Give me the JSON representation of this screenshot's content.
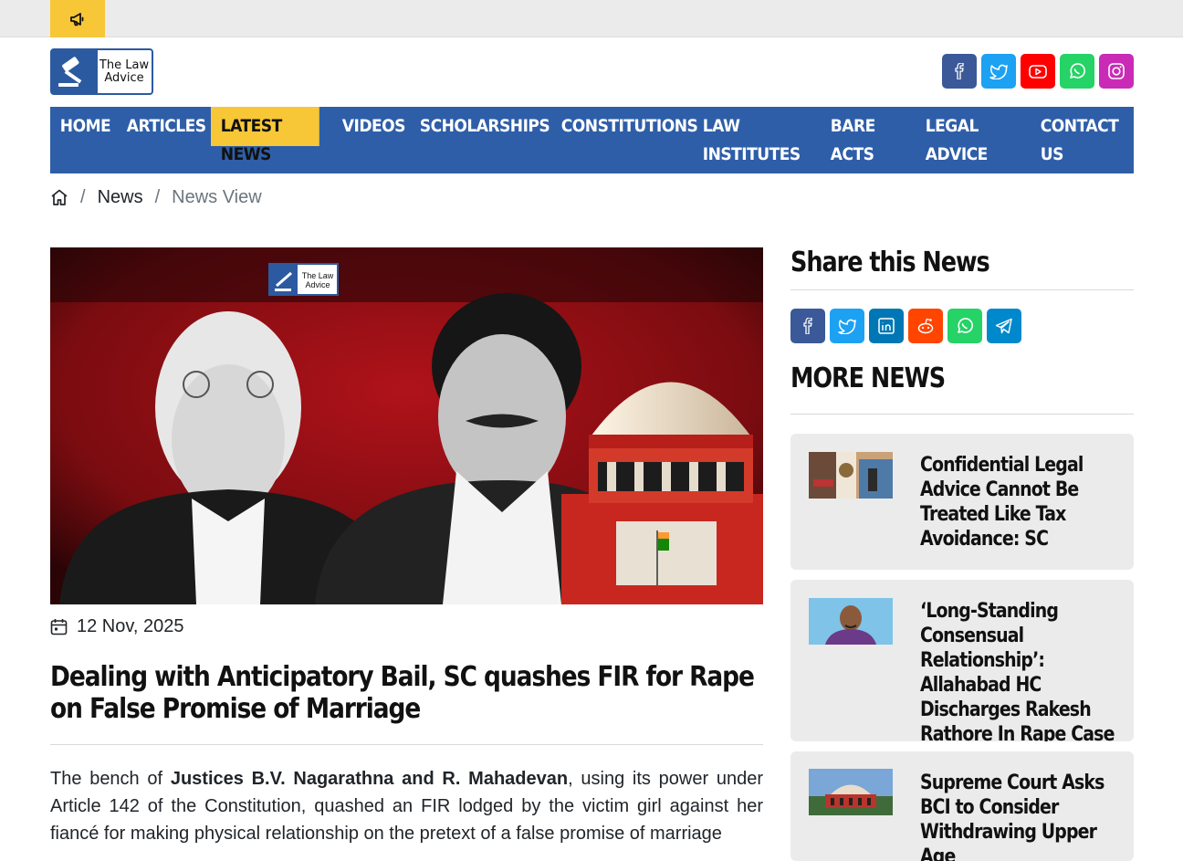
{
  "topbar": {
    "announcement_icon": "megaphone-icon"
  },
  "logo": {
    "line1": "The Law",
    "line2": "Advice"
  },
  "socials": [
    {
      "name": "facebook-icon",
      "color": "#3b5998"
    },
    {
      "name": "twitter-icon",
      "color": "#1da1f2"
    },
    {
      "name": "youtube-icon",
      "color": "#ff0000"
    },
    {
      "name": "whatsapp-icon",
      "color": "#25d366"
    },
    {
      "name": "instagram-icon",
      "color": "#c13584"
    }
  ],
  "nav": {
    "items": [
      {
        "label": "HOME"
      },
      {
        "label": "ARTICLES"
      },
      {
        "label": "LATEST NEWS",
        "active": true
      },
      {
        "label": "VIDEOS"
      },
      {
        "label": "SCHOLARSHIPS"
      },
      {
        "label": "CONSTITUTIONS"
      },
      {
        "label": "LAW INSTITUTES"
      },
      {
        "label": "BARE ACTS"
      },
      {
        "label": "LEGAL ADVICE"
      },
      {
        "label": "CONTACT US"
      }
    ],
    "bg_color": "#2e5ea8",
    "active_color": "#f7c737"
  },
  "breadcrumb": {
    "home_icon": "home-icon",
    "sep": "/",
    "news": "News",
    "current": "News View"
  },
  "hero": {
    "logo_line1": "The Law",
    "logo_line2": "Advice"
  },
  "article": {
    "date": "12 Nov, 2025",
    "title": "Dealing with Anticipatory Bail, SC quashes FIR for Rape on False Promise of Marriage",
    "body_prefix": "The bench of ",
    "body_bold": "Justices B.V. Nagarathna and R. Mahadevan",
    "body_rest": ", using its power under Article 142 of the Constitution, quashed an FIR lodged by the victim girl against her fiancé for making physical relationship on the pretext of a false promise of marriage"
  },
  "sidebar": {
    "share_heading": "Share this News",
    "share_buttons": [
      {
        "name": "share-facebook-icon",
        "color": "#3b5998"
      },
      {
        "name": "share-twitter-icon",
        "color": "#1da1f2"
      },
      {
        "name": "share-linkedin-icon",
        "color": "#0077b5"
      },
      {
        "name": "share-reddit-icon",
        "color": "#ff4500"
      },
      {
        "name": "share-whatsapp-icon",
        "color": "#25d366"
      },
      {
        "name": "share-telegram-icon",
        "color": "#0088cc"
      }
    ],
    "more_heading": "MORE NEWS",
    "news": [
      {
        "title": "Confidential Legal Advice Cannot Be Treated Like Tax Avoidance: SC"
      },
      {
        "title": "‘Long-Standing Consensual Relationship’: Allahabad HC Discharges Rakesh Rathore In Rape Case"
      },
      {
        "title": "Supreme Court Asks BCI to Consider Withdrawing Upper Age"
      }
    ]
  }
}
